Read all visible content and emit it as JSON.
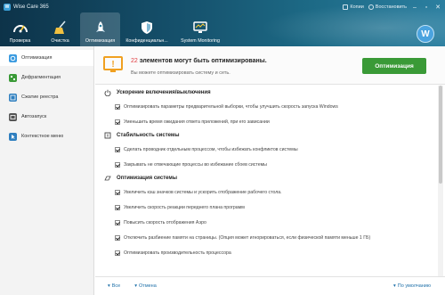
{
  "app": {
    "title": "Wise Care 365"
  },
  "titlebar": {
    "copy_label": "Копии",
    "restore_label": "Восстановить",
    "minimize": "‒",
    "maximize": "▫",
    "close": "✕"
  },
  "nav": [
    {
      "label": "Проверка",
      "icon": "gauge-icon"
    },
    {
      "label": "Очистка",
      "icon": "broom-icon"
    },
    {
      "label": "Оптимизация",
      "icon": "rocket-icon"
    },
    {
      "label": "Конфиденциальн...",
      "icon": "shield-icon"
    },
    {
      "label": "System Monitoring",
      "icon": "monitor-icon"
    }
  ],
  "avatar_letter": "W",
  "sidebar": [
    {
      "label": "Оптимизация",
      "icon": "optimize-icon",
      "color": "#3b9be0"
    },
    {
      "label": "Дефрагментация",
      "icon": "defrag-icon",
      "color": "#3a9a37"
    },
    {
      "label": "Сжатие реестра",
      "icon": "registry-icon",
      "color": "#2f7fbf"
    },
    {
      "label": "Автозапуск",
      "icon": "startup-icon",
      "color": "#555555"
    },
    {
      "label": "Контекстное меню",
      "icon": "context-menu-icon",
      "color": "#2f7fbf"
    }
  ],
  "banner": {
    "count": "22",
    "title_rest": " элементов могут быть оптимизированы.",
    "subtitle": "Вы можете оптимизировать систему и сеть.",
    "button": "Оптимизация"
  },
  "sections": [
    {
      "title": "Ускорение включения/выключения",
      "icon": "power-icon",
      "items": [
        "Оптимизировать параметры предварительной выборки, чтобы улучшить скорость запуска Windows",
        "Уменьшить время ожидания ответа приложений, при его зависании"
      ]
    },
    {
      "title": "Стабильность системы",
      "icon": "stability-icon",
      "items": [
        "Сделать проводник отдельным процессом, чтобы избежать конфликтов системы",
        "Закрывать не отвечающие процессы во избежание сбоев системы"
      ]
    },
    {
      "title": "Оптимизация системы",
      "icon": "speed-icon",
      "items": [
        "Увеличить кэш значков системы и ускорить отображение рабочего стола.",
        "Увеличить скорость реакции переднего плана программ",
        "Повысить скорость отображения Аэро",
        "Отключить разбиение памяти на страницы. (Опция может игнорироваться, если физической памяти меньше 1 ГБ)",
        "Оптимизировать производительность процессора"
      ]
    }
  ],
  "footer": {
    "all": "Все",
    "none": "Отмена",
    "default": "По умолчанию"
  },
  "colors": {
    "accent_green": "#3a9a37",
    "count_red": "#e0393e",
    "link_blue": "#1d6fa8"
  }
}
